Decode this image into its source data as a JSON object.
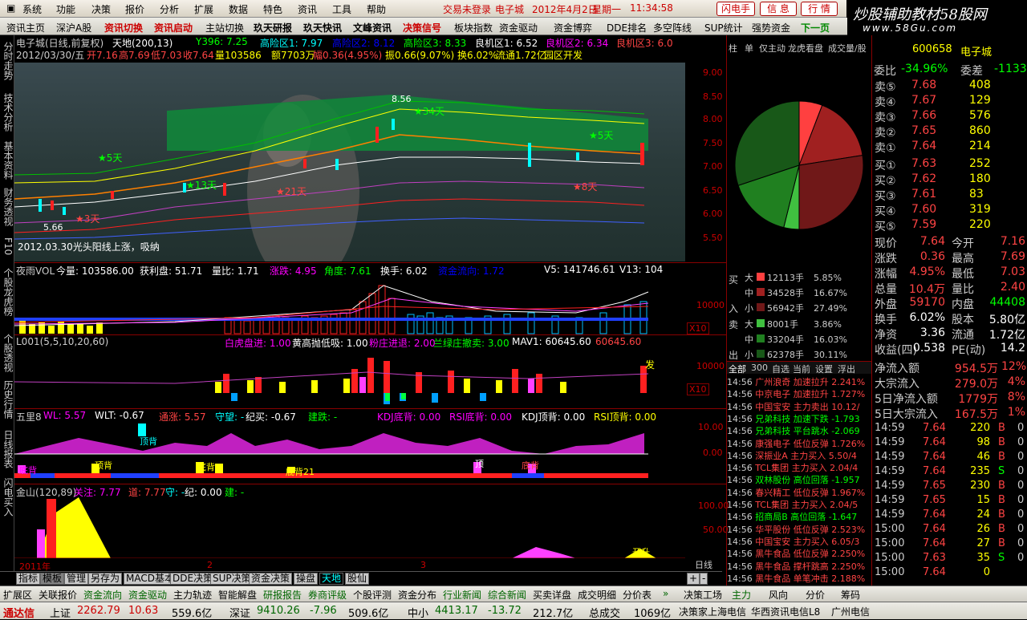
{
  "menu": {
    "items": [
      "系统",
      "功能",
      "决策",
      "报价",
      "分析",
      "扩展",
      "数据",
      "特色",
      "资讯",
      "工具",
      "帮助"
    ],
    "status": "交易未登录",
    "stock": "电子城",
    "date": "2012年4月2日",
    "weekday": "星期一",
    "time": "11:34:58",
    "btn_lightning": "闪电手",
    "btn_letter": "信 息",
    "btn_market": "行 情"
  },
  "logo": {
    "title": "炒股辅助教材58股网",
    "url": "www.58Gu.com"
  },
  "toolbar": {
    "items": [
      "资讯主页",
      "深沪A股",
      "资讯切换",
      "资讯启动",
      "主站切换",
      "玖天研报",
      "玖天快讯",
      "文峰资讯",
      "决策信号",
      "板块指数",
      "资金驱动",
      "资金博弈",
      "DDE排名",
      "多空阵线",
      "SUP统计",
      "强势资金"
    ],
    "next": "下一页"
  },
  "lefttabs": [
    "分时走势",
    "技术分析",
    "基本资料",
    "财务透视",
    "F10",
    "个股龙虎榜",
    "个股透视",
    "历史行情",
    "日线报表",
    "闪电买入"
  ],
  "chart": {
    "title": "电子城(日线,前复权)",
    "t1": "天地(200,13)",
    "t2": "Y396: 7.25",
    "t3": "高险区1: 7.97",
    "t4": "高险区2: 8.12",
    "t5": "高险区3: 8.33",
    "t6": "良机区1: 6.52",
    "t7": "良机区2: 6.34",
    "t8": "良机区3: 6.0",
    "ohlc_date": "2012/03/30/五",
    "open": "开7.16",
    "high": "高7.69",
    "low": "低7.03",
    "close": "收7.64",
    "vol": "量103586",
    "amount": "额7703万",
    "chg": "幅0.36(4.95%)",
    "amp": "振0.66(9.07%)",
    "turn": "换6.02%",
    "float": "流通1.72亿",
    "region": "园区开发",
    "note": "2012.03.30光头阳线上涨，吸纳",
    "low_mark": "5.66",
    "high_mark": "8.56",
    "yticks": [
      "9.00",
      "8.50",
      "8.00",
      "7.50",
      "7.00",
      "6.50",
      "6.00",
      "5.50"
    ],
    "stars": [
      "5天",
      "13天",
      "21天",
      "34天",
      "5天",
      "3天",
      "8天"
    ]
  },
  "vol": {
    "title": "夜雨VOL",
    "qty": "今量: 103586.00",
    "profit": "获利盘: 51.71",
    "ratio": "量比: 1.71",
    "rise": "涨跌: 4.95",
    "angle": "角度: 7.61",
    "turn": "换手: 6.02",
    "amt": "资金流向: 1.72",
    "v5": "V5: 141746.61",
    "v13": "V13: 104",
    "ytick": "10000",
    "x10": "X10"
  },
  "l001": {
    "title": "L001(5,5,10,20,60)",
    "a": "白虎盘进: 1.00",
    "b": "黄高抛低吸: 1.00",
    "c": "粉庄进退: 2.00",
    "d": "兰绿庄撤卖: 3.00",
    "e": "MAV1: 60645.60",
    "f": "60645.60",
    "ytick": "10000",
    "x10": "X10",
    "fa": "发"
  },
  "wuli": {
    "title": "五里8",
    "wl": "WL: 5.57",
    "wlt": "WLT: -0.67",
    "tong": "通涨: 5.57",
    "shou": "守望: -",
    "ji": "纪买: -0.67",
    "jian": "建跌: -",
    "kdj": "KDJ底背: 0.00",
    "rsi": "RSI底背: 0.00",
    "kdj2": "KDJ顶背: 0.00",
    "rsi2": "RSI顶背: 0.00",
    "y1": "10.00",
    "y0": "0.00",
    "labels": [
      "底背",
      "顶背",
      "顶背",
      "底背",
      "底背21",
      "顶",
      "底背"
    ]
  },
  "jinshan": {
    "title": "金山(120,89)",
    "a": "关注: 7.77",
    "b": "道: 7.77",
    "c": "守: -",
    "d": "纪: 0.00",
    "e": "建: -",
    "y1": "100.00",
    "y2": "50.00",
    "x1": "2011年",
    "x2": "2",
    "x3": "3",
    "lbl": "开升"
  },
  "bottomtabs": [
    "指标",
    "模板",
    "管理",
    "另存为",
    "MACD基本",
    "DDE决策",
    "SUP决策",
    "资金决策",
    "操盘",
    "天地",
    "股仙"
  ],
  "navbar": [
    "扩展区",
    "关联报价",
    "资金流向",
    "资金驱动",
    "主力轨迹",
    "智能解盘",
    "研报报告",
    "券商评级",
    "个股评测",
    "资金分布",
    "行业新闻",
    "综合新闻",
    "买卖详盘",
    "成交明细",
    "分价表",
    "决策工场"
  ],
  "navbar_right": [
    "主力",
    "风向",
    "分价",
    "筹码"
  ],
  "status": {
    "brand": "通达信",
    "sh_name": "上证",
    "sh": "2262.79",
    "sh_chg": "10.63",
    "sh_amt": "559.6亿",
    "sz_name": "深证",
    "sz": "9410.26",
    "sz_chg": "-7.96",
    "sz_amt": "509.6亿",
    "zx_name": "中小",
    "zx": "4413.17",
    "zx_chg": "-13.72",
    "zx_amt": "212.7亿",
    "total": "总成交",
    "total_amt": "1069亿",
    "c1": "决策家上海电信",
    "c2": "华西资讯电信L8",
    "c3": "广州电信"
  },
  "tabs_right": [
    "柱",
    "单",
    "仅主动",
    "龙虎看盘",
    "成交量/股"
  ],
  "quote": {
    "code": "600658",
    "name": "电子城",
    "wb_label": "委比",
    "wb": "-34.96%",
    "wc_label": "委差",
    "wc": "-1133",
    "sells": [
      {
        "l": "卖⑤",
        "p": "7.68",
        "v": "408"
      },
      {
        "l": "卖④",
        "p": "7.67",
        "v": "129"
      },
      {
        "l": "卖③",
        "p": "7.66",
        "v": "576"
      },
      {
        "l": "卖②",
        "p": "7.65",
        "v": "860"
      },
      {
        "l": "卖①",
        "p": "7.64",
        "v": "214"
      }
    ],
    "buys": [
      {
        "l": "买①",
        "p": "7.63",
        "v": "252"
      },
      {
        "l": "买②",
        "p": "7.62",
        "v": "180"
      },
      {
        "l": "买③",
        "p": "7.61",
        "v": "83"
      },
      {
        "l": "买④",
        "p": "7.60",
        "v": "319"
      },
      {
        "l": "买⑤",
        "p": "7.59",
        "v": "220"
      }
    ],
    "stats": [
      [
        "现价",
        "7.64",
        "今开",
        "7.16"
      ],
      [
        "涨跌",
        "0.36",
        "最高",
        "7.69"
      ],
      [
        "涨幅",
        "4.95%",
        "最低",
        "7.03"
      ],
      [
        "总量",
        "10.4万",
        "量比",
        "2.40"
      ],
      [
        "外盘",
        "59170",
        "内盘",
        "44408"
      ],
      [
        "换手",
        "6.02%",
        "股本",
        "5.80亿"
      ],
      [
        "净资",
        "3.36",
        "流通",
        "1.72亿"
      ],
      [
        "收益(四)",
        "0.538",
        "PE(动)",
        "14.2"
      ]
    ],
    "flow": [
      [
        "净流入额",
        "954.5万",
        "12%"
      ],
      [
        "大宗流入",
        "279.0万",
        "4%"
      ],
      [
        "5日净流入额",
        "1779万",
        "8%"
      ],
      [
        "5日大宗流入",
        "167.5万",
        "1%"
      ]
    ],
    "ticks": [
      [
        "14:59",
        "7.64",
        "220",
        "B",
        "0"
      ],
      [
        "14:59",
        "7.64",
        "98",
        "B",
        "0"
      ],
      [
        "14:59",
        "7.64",
        "46",
        "B",
        "0"
      ],
      [
        "14:59",
        "7.64",
        "235",
        "S",
        "0"
      ],
      [
        "14:59",
        "7.65",
        "230",
        "B",
        "0"
      ],
      [
        "14:59",
        "7.65",
        "15",
        "B",
        "0"
      ],
      [
        "14:59",
        "7.64",
        "24",
        "B",
        "0"
      ],
      [
        "15:00",
        "7.64",
        "26",
        "B",
        "0"
      ],
      [
        "15:00",
        "7.64",
        "27",
        "B",
        "0"
      ],
      [
        "15:00",
        "7.63",
        "35",
        "S",
        "0"
      ],
      [
        "15:00",
        "7.64",
        "0",
        "",
        ""
      ]
    ]
  },
  "pie": {
    "slices": [
      {
        "label": "大买",
        "value": 5.85,
        "color": "#ff4040"
      },
      {
        "label": "中买",
        "value": 16.67,
        "color": "#a02020"
      },
      {
        "label": "小买",
        "value": 27.49,
        "color": "#701818"
      },
      {
        "label": "大卖",
        "value": 3.86,
        "color": "#40c040"
      },
      {
        "label": "中卖",
        "value": 16.03,
        "color": "#208020"
      },
      {
        "label": "小卖",
        "value": 30.11,
        "color": "#185818"
      }
    ]
  },
  "money": {
    "buy": "买",
    "sell": "卖",
    "in": "入",
    "out": "出",
    "rows": [
      [
        "大",
        "12113手",
        "5.85%"
      ],
      [
        "中",
        "34528手",
        "16.67%"
      ],
      [
        "小",
        "56942手",
        "27.49%"
      ],
      [
        "大",
        "8001手",
        "3.86%"
      ],
      [
        "中",
        "33204手",
        "16.03%"
      ],
      [
        "小",
        "62378手",
        "30.11%"
      ]
    ]
  },
  "monitor_tabs": [
    "全部",
    "300",
    "自选",
    "当前",
    "设置",
    "浮出"
  ],
  "monitor": [
    [
      "14:56",
      "广州浪奇",
      "加速拉升",
      "2.241%"
    ],
    [
      "14:56",
      "中京电子",
      "加速拉升",
      "1.727%"
    ],
    [
      "14:56",
      "中国宝安",
      "主力卖出",
      "10.12/"
    ],
    [
      "14:56",
      "兄弟科技",
      "加速下跌",
      "-1.793"
    ],
    [
      "14:56",
      "兄弟科技",
      "平台跳水",
      "-2.069"
    ],
    [
      "14:56",
      "康强电子",
      "低位反弹",
      "1.726%"
    ],
    [
      "14:56",
      "深振业A",
      "主力买入",
      "5.50/4"
    ],
    [
      "14:56",
      "TCL集团",
      "主力买入",
      "2.04/4"
    ],
    [
      "14:56",
      "双林股份",
      "高位回落",
      "-1.957"
    ],
    [
      "14:56",
      "春兴精工",
      "低位反弹",
      "1.967%"
    ],
    [
      "14:56",
      "TCL集团",
      "主力买入",
      "2.04/5"
    ],
    [
      "14:56",
      "招商局B",
      "高位回落",
      "-1.647"
    ],
    [
      "14:56",
      "华平股份",
      "低位反弹",
      "2.523%"
    ],
    [
      "14:56",
      "中国宝安",
      "主力买入",
      "6.05/3"
    ],
    [
      "14:56",
      "黑牛食品",
      "低位反弹",
      "2.250%"
    ],
    [
      "14:56",
      "黑牛食品",
      "撑杆跳高",
      "2.250%"
    ],
    [
      "14:56",
      "黑牛食品",
      "单笔冲击",
      "2.188%"
    ]
  ],
  "y_axes_sep": "日线"
}
